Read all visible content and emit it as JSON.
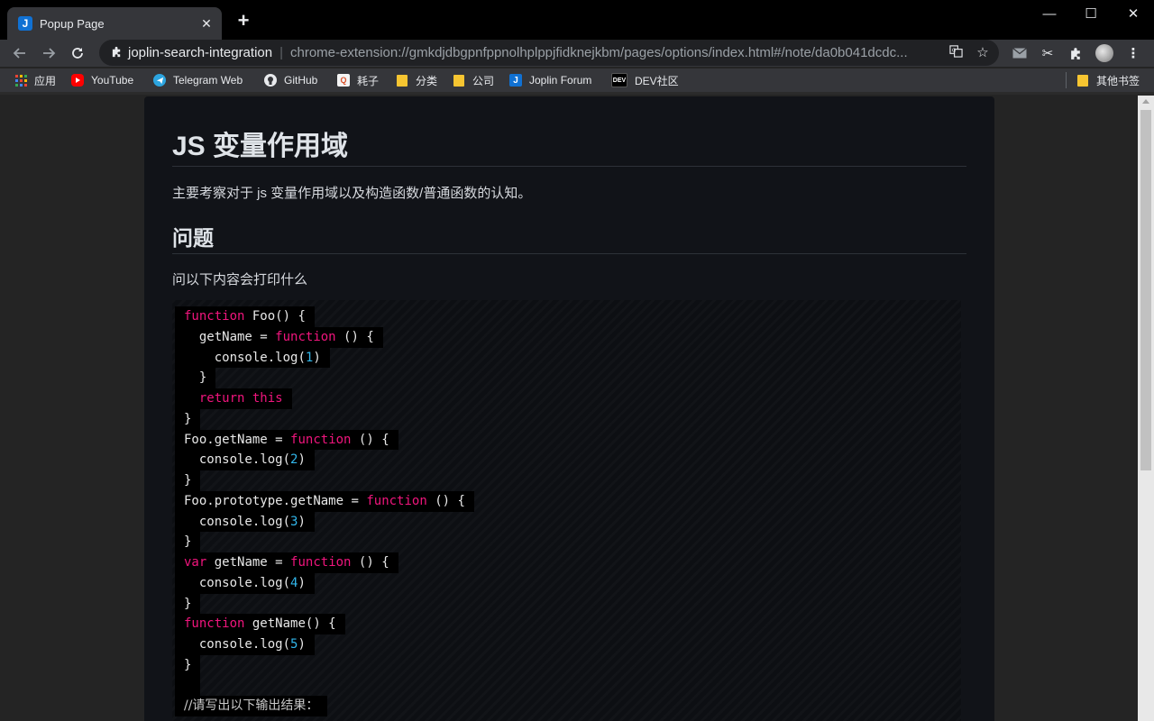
{
  "browser": {
    "tab": {
      "icon": "joplin-icon",
      "title": "Popup Page",
      "close": "✕"
    },
    "new_tab": "+",
    "window_controls": {
      "minimize": "—",
      "maximize": "☐",
      "close": "✕"
    },
    "address": {
      "site_name": "joplin-search-integration",
      "url": "chrome-extension://gmkdjdbgpnfppnolhplppjfidknejkbm/pages/options/index.html#/note/da0b041dcdc..."
    },
    "bookmarks": [
      {
        "label": "应用",
        "icon": "apps-grid-icon"
      },
      {
        "label": "YouTube",
        "icon": "youtube-icon"
      },
      {
        "label": "Telegram Web",
        "icon": "telegram-icon"
      },
      {
        "label": "GitHub",
        "icon": "github-icon"
      },
      {
        "label": "耗子",
        "icon": "site-icon"
      },
      {
        "label": "分类",
        "icon": "folder-icon"
      },
      {
        "label": "公司",
        "icon": "folder-icon"
      },
      {
        "label": "Joplin Forum",
        "icon": "joplin-icon"
      },
      {
        "label": "DEV社区",
        "icon": "dev-icon"
      }
    ],
    "other_bookmarks": "其他书签",
    "dev_badge": "DEV"
  },
  "note": {
    "title": "JS 变量作用域",
    "intro": "主要考察对于 js 变量作用域以及构造函数/普通函数的认知。",
    "section_heading": "问题",
    "question": "问以下内容会打印什么",
    "code": [
      "function Foo() {",
      "  getName = function () {",
      "    console.log(1)",
      "  }",
      "  return this",
      "}",
      "Foo.getName = function () {",
      "  console.log(2)",
      "}",
      "Foo.prototype.getName = function () {",
      "  console.log(3)",
      "}",
      "var getName = function () {",
      "  console.log(4)",
      "}",
      "function getName() {",
      "  console.log(5)",
      "}",
      "",
      "//请写出以下输出结果："
    ]
  },
  "colors": {
    "keyword": "#f0157d",
    "number": "#32b6ea",
    "page_bg": "#111318",
    "chrome_bg": "#35363a"
  }
}
